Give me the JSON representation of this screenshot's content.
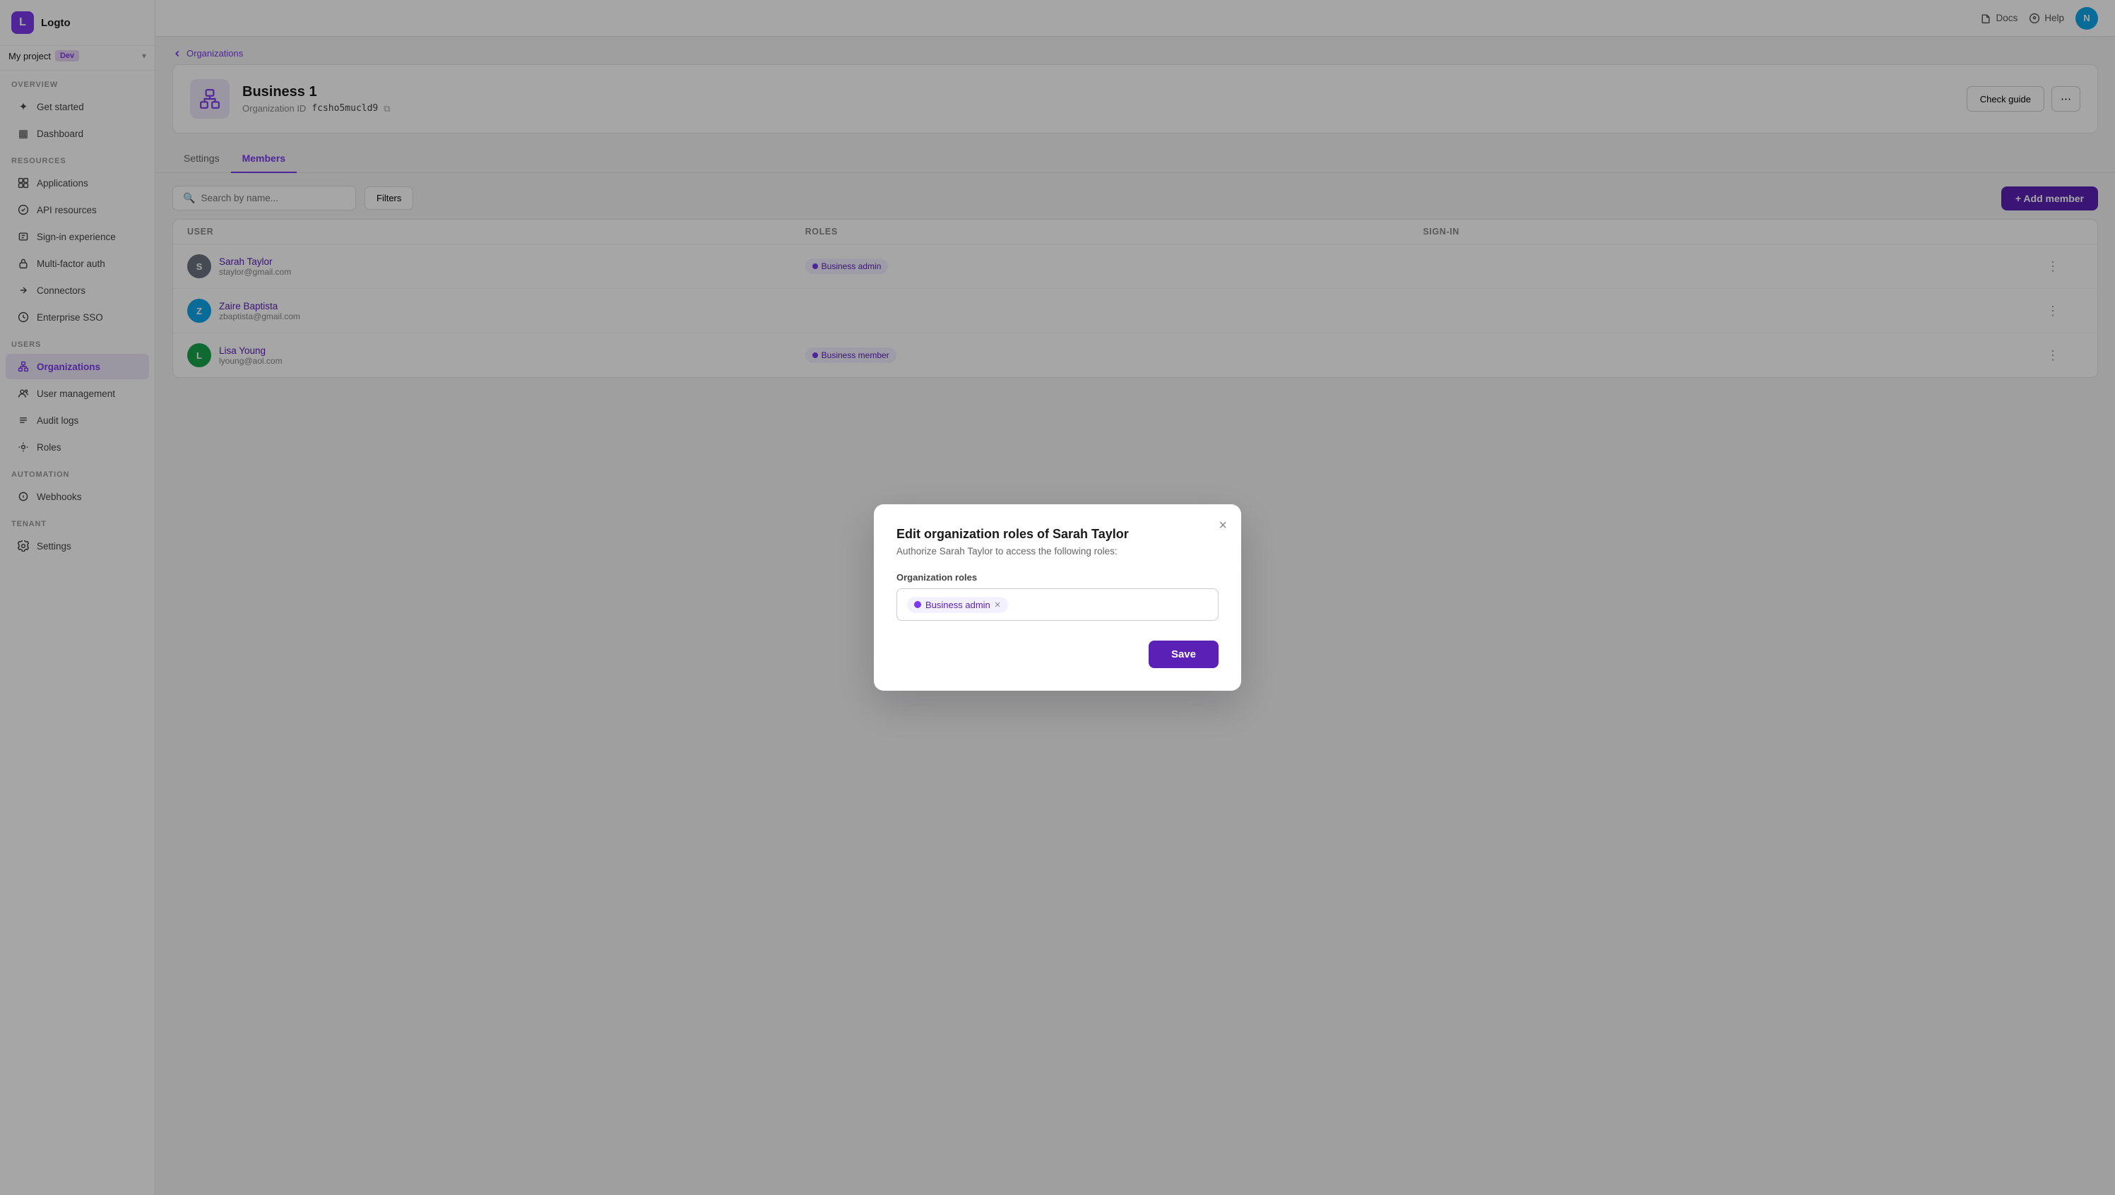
{
  "app": {
    "logo_text": "Logto",
    "logo_symbol": "L"
  },
  "project": {
    "name": "My project",
    "env": "Dev"
  },
  "topbar": {
    "docs_label": "Docs",
    "help_label": "Help",
    "avatar_initials": "N"
  },
  "sidebar": {
    "overview_label": "OVERVIEW",
    "resources_label": "RESOURCES",
    "users_label": "USERS",
    "automation_label": "AUTOMATION",
    "tenant_label": "TENANT",
    "items": [
      {
        "id": "get-started",
        "label": "Get started",
        "icon": "✦"
      },
      {
        "id": "dashboard",
        "label": "Dashboard",
        "icon": "▦"
      },
      {
        "id": "applications",
        "label": "Applications",
        "icon": "⬡"
      },
      {
        "id": "api-resources",
        "label": "API resources",
        "icon": "⚡"
      },
      {
        "id": "sign-in-experience",
        "label": "Sign-in experience",
        "icon": "⬢"
      },
      {
        "id": "multi-factor-auth",
        "label": "Multi-factor auth",
        "icon": "🔒"
      },
      {
        "id": "connectors",
        "label": "Connectors",
        "icon": "⬡"
      },
      {
        "id": "enterprise-sso",
        "label": "Enterprise SSO",
        "icon": "⬡"
      },
      {
        "id": "organizations",
        "label": "Organizations",
        "icon": "⬡",
        "active": true
      },
      {
        "id": "user-management",
        "label": "User management",
        "icon": "👤"
      },
      {
        "id": "audit-logs",
        "label": "Audit logs",
        "icon": "≡"
      },
      {
        "id": "roles",
        "label": "Roles",
        "icon": "⬡"
      },
      {
        "id": "webhooks",
        "label": "Webhooks",
        "icon": "⬡"
      },
      {
        "id": "settings",
        "label": "Settings",
        "icon": "⚙"
      }
    ]
  },
  "breadcrumb": {
    "label": "Organizations"
  },
  "org": {
    "name": "Business 1",
    "id_label": "Organization ID",
    "id_value": "fcsho5mucld9",
    "check_guide_label": "Check guide"
  },
  "tabs": [
    {
      "id": "settings",
      "label": "Settings"
    },
    {
      "id": "members",
      "label": "Members",
      "active": true
    }
  ],
  "members": {
    "search_placeholder": "Search by name...",
    "filter_label": "Filters",
    "add_member_label": "+ Add member",
    "columns": [
      "User",
      "Roles",
      "Sign-in"
    ],
    "rows": [
      {
        "initials": "S",
        "bg": "#6b7280",
        "name": "Sarah Taylor",
        "email": "staylor@gmail.com",
        "role": "Business admin",
        "signin": ""
      },
      {
        "initials": "Z",
        "bg": "#0ea5e9",
        "name": "Zaire Baptista",
        "email": "zbaptista@gmail.com",
        "role": "",
        "signin": ""
      },
      {
        "initials": "L",
        "bg": "#16a34a",
        "name": "Lisa Young",
        "email": "lyoung@aol.com",
        "role": "Business member",
        "signin": ""
      }
    ]
  },
  "modal": {
    "title": "Edit organization roles of Sarah Taylor",
    "subtitle": "Authorize Sarah Taylor to access the following roles:",
    "field_label": "Organization roles",
    "role_tag": "Business admin",
    "save_label": "Save",
    "close_label": "×"
  }
}
